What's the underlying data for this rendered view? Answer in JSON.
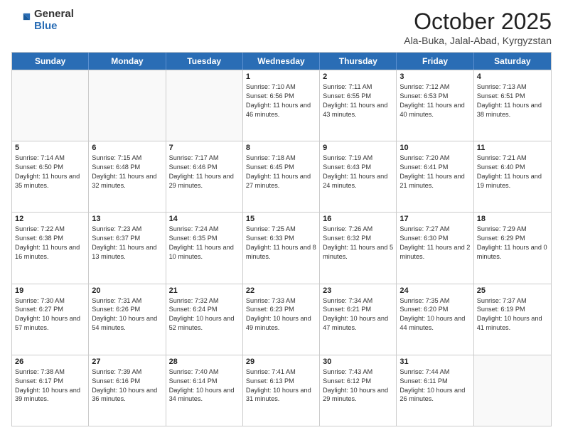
{
  "logo": {
    "general": "General",
    "blue": "Blue"
  },
  "header": {
    "month": "October 2025",
    "location": "Ala-Buka, Jalal-Abad, Kyrgyzstan"
  },
  "days": [
    "Sunday",
    "Monday",
    "Tuesday",
    "Wednesday",
    "Thursday",
    "Friday",
    "Saturday"
  ],
  "rows": [
    [
      {
        "day": "",
        "info": ""
      },
      {
        "day": "",
        "info": ""
      },
      {
        "day": "",
        "info": ""
      },
      {
        "day": "1",
        "info": "Sunrise: 7:10 AM\nSunset: 6:56 PM\nDaylight: 11 hours and 46 minutes."
      },
      {
        "day": "2",
        "info": "Sunrise: 7:11 AM\nSunset: 6:55 PM\nDaylight: 11 hours and 43 minutes."
      },
      {
        "day": "3",
        "info": "Sunrise: 7:12 AM\nSunset: 6:53 PM\nDaylight: 11 hours and 40 minutes."
      },
      {
        "day": "4",
        "info": "Sunrise: 7:13 AM\nSunset: 6:51 PM\nDaylight: 11 hours and 38 minutes."
      }
    ],
    [
      {
        "day": "5",
        "info": "Sunrise: 7:14 AM\nSunset: 6:50 PM\nDaylight: 11 hours and 35 minutes."
      },
      {
        "day": "6",
        "info": "Sunrise: 7:15 AM\nSunset: 6:48 PM\nDaylight: 11 hours and 32 minutes."
      },
      {
        "day": "7",
        "info": "Sunrise: 7:17 AM\nSunset: 6:46 PM\nDaylight: 11 hours and 29 minutes."
      },
      {
        "day": "8",
        "info": "Sunrise: 7:18 AM\nSunset: 6:45 PM\nDaylight: 11 hours and 27 minutes."
      },
      {
        "day": "9",
        "info": "Sunrise: 7:19 AM\nSunset: 6:43 PM\nDaylight: 11 hours and 24 minutes."
      },
      {
        "day": "10",
        "info": "Sunrise: 7:20 AM\nSunset: 6:41 PM\nDaylight: 11 hours and 21 minutes."
      },
      {
        "day": "11",
        "info": "Sunrise: 7:21 AM\nSunset: 6:40 PM\nDaylight: 11 hours and 19 minutes."
      }
    ],
    [
      {
        "day": "12",
        "info": "Sunrise: 7:22 AM\nSunset: 6:38 PM\nDaylight: 11 hours and 16 minutes."
      },
      {
        "day": "13",
        "info": "Sunrise: 7:23 AM\nSunset: 6:37 PM\nDaylight: 11 hours and 13 minutes."
      },
      {
        "day": "14",
        "info": "Sunrise: 7:24 AM\nSunset: 6:35 PM\nDaylight: 11 hours and 10 minutes."
      },
      {
        "day": "15",
        "info": "Sunrise: 7:25 AM\nSunset: 6:33 PM\nDaylight: 11 hours and 8 minutes."
      },
      {
        "day": "16",
        "info": "Sunrise: 7:26 AM\nSunset: 6:32 PM\nDaylight: 11 hours and 5 minutes."
      },
      {
        "day": "17",
        "info": "Sunrise: 7:27 AM\nSunset: 6:30 PM\nDaylight: 11 hours and 2 minutes."
      },
      {
        "day": "18",
        "info": "Sunrise: 7:29 AM\nSunset: 6:29 PM\nDaylight: 11 hours and 0 minutes."
      }
    ],
    [
      {
        "day": "19",
        "info": "Sunrise: 7:30 AM\nSunset: 6:27 PM\nDaylight: 10 hours and 57 minutes."
      },
      {
        "day": "20",
        "info": "Sunrise: 7:31 AM\nSunset: 6:26 PM\nDaylight: 10 hours and 54 minutes."
      },
      {
        "day": "21",
        "info": "Sunrise: 7:32 AM\nSunset: 6:24 PM\nDaylight: 10 hours and 52 minutes."
      },
      {
        "day": "22",
        "info": "Sunrise: 7:33 AM\nSunset: 6:23 PM\nDaylight: 10 hours and 49 minutes."
      },
      {
        "day": "23",
        "info": "Sunrise: 7:34 AM\nSunset: 6:21 PM\nDaylight: 10 hours and 47 minutes."
      },
      {
        "day": "24",
        "info": "Sunrise: 7:35 AM\nSunset: 6:20 PM\nDaylight: 10 hours and 44 minutes."
      },
      {
        "day": "25",
        "info": "Sunrise: 7:37 AM\nSunset: 6:19 PM\nDaylight: 10 hours and 41 minutes."
      }
    ],
    [
      {
        "day": "26",
        "info": "Sunrise: 7:38 AM\nSunset: 6:17 PM\nDaylight: 10 hours and 39 minutes."
      },
      {
        "day": "27",
        "info": "Sunrise: 7:39 AM\nSunset: 6:16 PM\nDaylight: 10 hours and 36 minutes."
      },
      {
        "day": "28",
        "info": "Sunrise: 7:40 AM\nSunset: 6:14 PM\nDaylight: 10 hours and 34 minutes."
      },
      {
        "day": "29",
        "info": "Sunrise: 7:41 AM\nSunset: 6:13 PM\nDaylight: 10 hours and 31 minutes."
      },
      {
        "day": "30",
        "info": "Sunrise: 7:43 AM\nSunset: 6:12 PM\nDaylight: 10 hours and 29 minutes."
      },
      {
        "day": "31",
        "info": "Sunrise: 7:44 AM\nSunset: 6:11 PM\nDaylight: 10 hours and 26 minutes."
      },
      {
        "day": "",
        "info": ""
      }
    ]
  ]
}
